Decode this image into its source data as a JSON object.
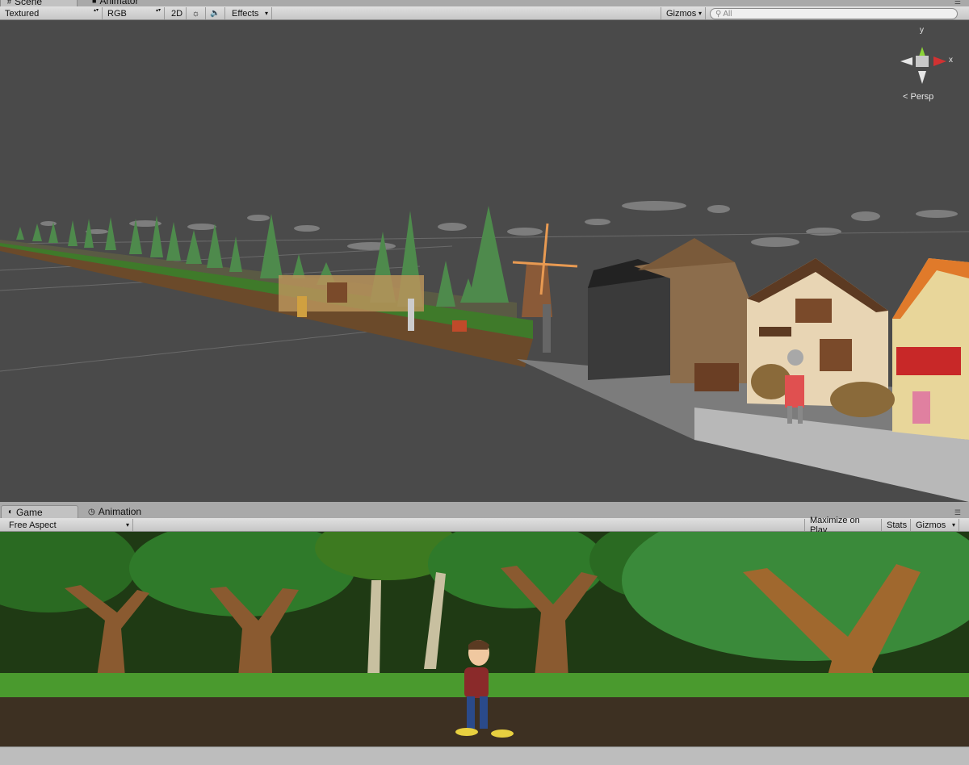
{
  "scene_panel": {
    "tabs": [
      {
        "label": "Scene",
        "icon": "hash-icon"
      },
      {
        "label": "Animator",
        "icon": "animator-icon"
      }
    ],
    "toolbar": {
      "draw_mode": "Textured",
      "render_mode": "RGB",
      "mode_2d": "2D",
      "lighting_icon": "sun-icon",
      "audio_icon": "speaker-icon",
      "effects": "Effects",
      "gizmos": "Gizmos",
      "search_placeholder": "All"
    },
    "orientation_gizmo": {
      "y_label": "y",
      "x_label": "x",
      "projection": "Persp"
    }
  },
  "game_panel": {
    "tabs": [
      {
        "label": "Game",
        "icon": "game-icon"
      },
      {
        "label": "Animation",
        "icon": "clock-icon"
      }
    ],
    "toolbar": {
      "aspect": "Free Aspect",
      "maximize": "Maximize on Play",
      "stats": "Stats",
      "gizmos": "Gizmos"
    }
  },
  "colors": {
    "scene_background": "#4a4a4a",
    "toolbar": "#d2d2d2",
    "forest_dark": "#1f3a14",
    "ground": "#3d3022"
  }
}
